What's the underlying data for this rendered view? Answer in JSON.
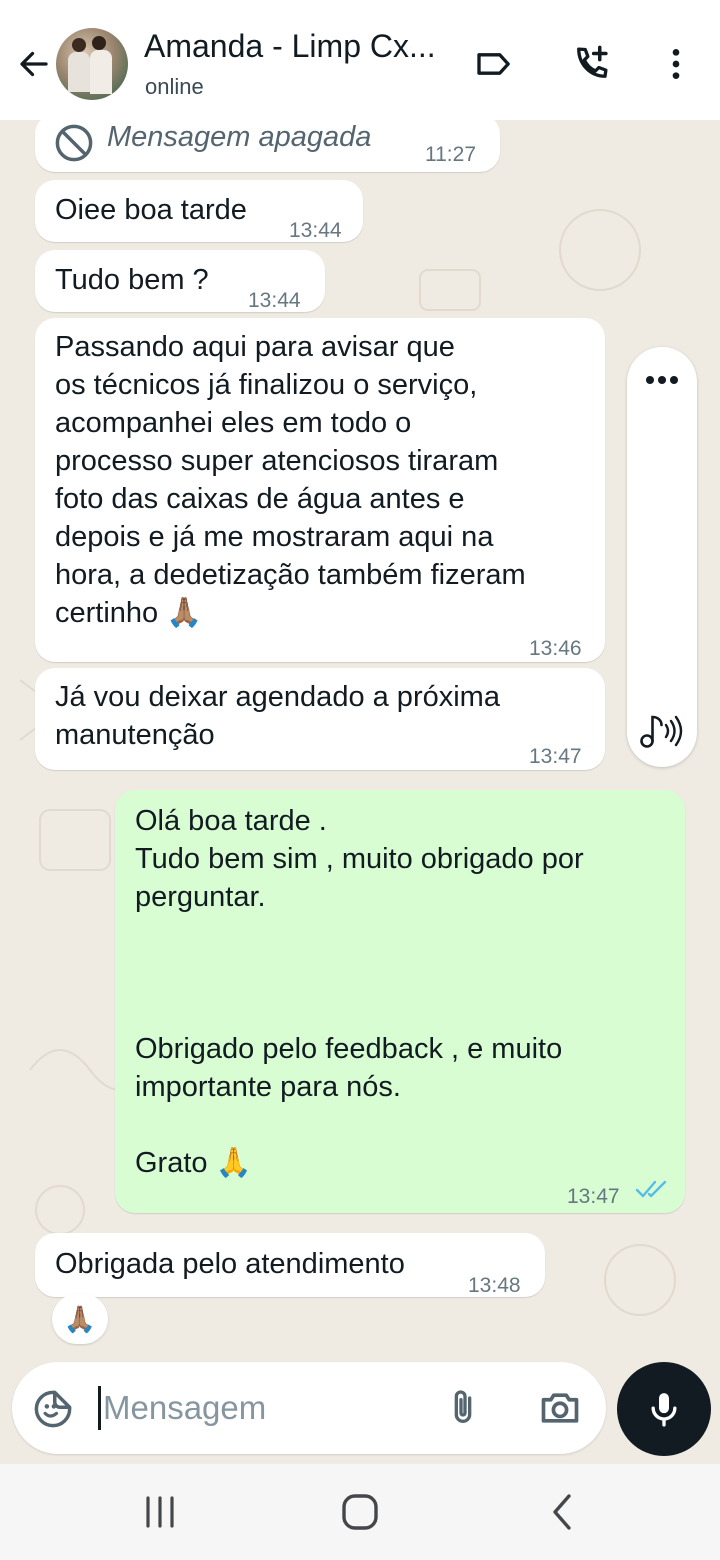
{
  "header": {
    "contact_name": "Amanda - Limp Cx...",
    "status": "online"
  },
  "messages": [
    {
      "text": "Mensagem apagada",
      "time": "11:27",
      "direction": "in",
      "deleted": true
    },
    {
      "text": "Oiee boa tarde",
      "time": "13:44",
      "direction": "in"
    },
    {
      "text": "Tudo bem ?",
      "time": "13:44",
      "direction": "in"
    },
    {
      "text": "Passando aqui para avisar que\nos técnicos já finalizou o serviço,\nacompanhei eles em todo o\nprocesso super atenciosos tiraram\nfoto das caixas de água antes e\ndepois e já me mostraram aqui na\nhora, a dedetização também fizeram\ncertinho 🙏🏽",
      "time": "13:46",
      "direction": "in"
    },
    {
      "text": "Já vou deixar agendado a próxima\nmanutenção",
      "time": "13:47",
      "direction": "in"
    },
    {
      "text": "Olá boa tarde .\nTudo bem sim , muito obrigado por\nperguntar.\n\n\n\nObrigado pelo feedback , e muito\nimportante para nós.\n\nGrato 🙏",
      "time": "13:47",
      "direction": "out",
      "read": true
    },
    {
      "text": "Obrigada pelo atendimento",
      "time": "13:48",
      "direction": "in",
      "reaction": "🙏🏽"
    }
  ],
  "input": {
    "placeholder": "Mensagem"
  },
  "icons": {
    "back": "arrow-left-icon",
    "label": "label-tag-icon",
    "add_call": "phone-plus-icon",
    "menu": "more-vertical-icon",
    "emoji": "sticker-icon",
    "attach": "paperclip-icon",
    "camera": "camera-icon",
    "mic": "microphone-icon",
    "read_receipt": "double-check-icon"
  },
  "colors": {
    "chat_background": "#efeae2",
    "incoming_bubble": "#ffffff",
    "outgoing_bubble": "#d9fdd3",
    "read_check": "#53bdeb",
    "mic_button": "#111b21"
  }
}
